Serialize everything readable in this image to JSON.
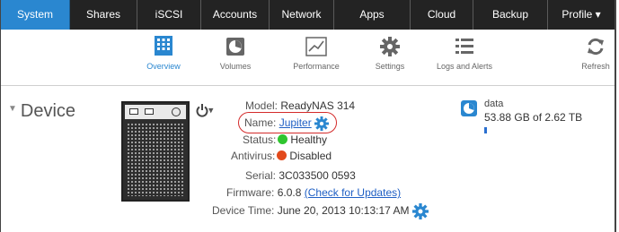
{
  "topnav": {
    "tabs": [
      {
        "label": "System",
        "active": true
      },
      {
        "label": "Shares",
        "active": false
      },
      {
        "label": "iSCSI",
        "active": false
      },
      {
        "label": "Accounts",
        "active": false
      },
      {
        "label": "Network",
        "active": false
      },
      {
        "label": "Apps",
        "active": false
      },
      {
        "label": "Cloud",
        "active": false
      },
      {
        "label": "Backup",
        "active": false
      },
      {
        "label": "Profile ▾",
        "active": false
      }
    ]
  },
  "subnav": {
    "items": [
      {
        "label": "Overview",
        "icon": "overview-icon",
        "active": true
      },
      {
        "label": "Volumes",
        "icon": "volumes-icon",
        "active": false
      },
      {
        "label": "Performance",
        "icon": "performance-icon",
        "active": false
      },
      {
        "label": "Settings",
        "icon": "settings-icon",
        "active": false
      },
      {
        "label": "Logs and Alerts",
        "icon": "logs-icon",
        "active": false
      },
      {
        "label": "Refresh",
        "icon": "refresh-icon",
        "active": false
      }
    ]
  },
  "device": {
    "section_title": "Device",
    "power_menu_caret": "▾",
    "model_label": "Model:",
    "model_value": "ReadyNAS 314",
    "name_label": "Name:",
    "name_value": "Jupiter",
    "status_label": "Status:",
    "status_value": "Healthy",
    "antivirus_label": "Antivirus:",
    "antivirus_value": "Disabled",
    "serial_label": "Serial:",
    "serial_value": "3C033500 0593",
    "firmware_label": "Firmware:",
    "firmware_value": "6.0.8",
    "firmware_link": "(Check for Updates)",
    "time_label": "Device Time:",
    "time_value": "June 20, 2013 10:13:17 AM"
  },
  "volume": {
    "name": "data",
    "size": "53.88 GB of 2.62 TB",
    "usage_fraction": 0.02
  },
  "colors": {
    "accent": "#2a87d0",
    "healthy": "#2fc52f",
    "disabled": "#e24a1c",
    "highlight_ring": "#d42b2b"
  }
}
